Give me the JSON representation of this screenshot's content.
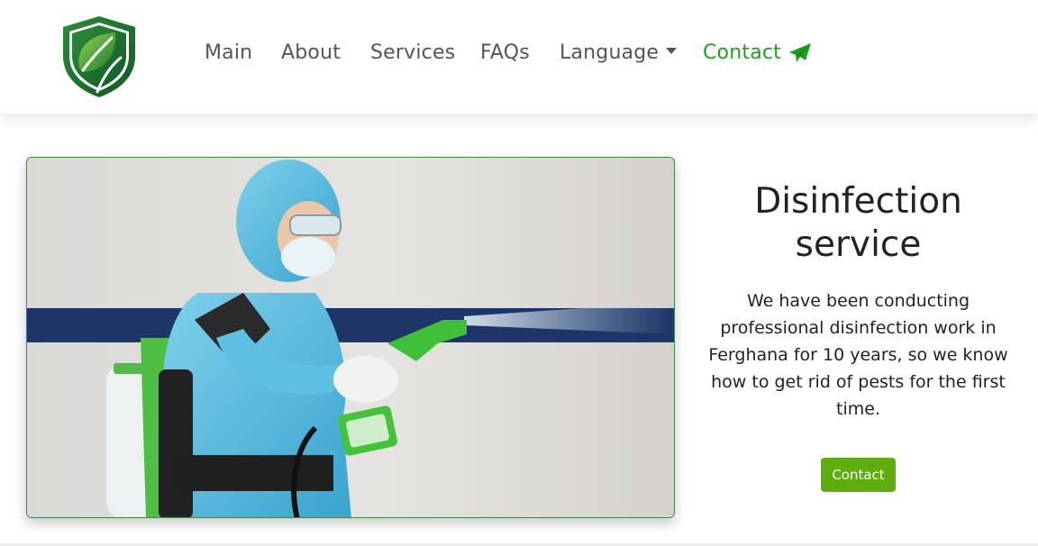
{
  "navbar": {
    "logo_icon": "shield-leaf-logo",
    "items": [
      {
        "label": "Main"
      },
      {
        "label": "About"
      },
      {
        "label": "Services"
      },
      {
        "label": "FAQs"
      },
      {
        "label": "Language"
      },
      {
        "label": "Contact"
      }
    ],
    "contact_icon": "paper-plane-icon"
  },
  "hero": {
    "title": "Disinfection service",
    "description": "We have been conducting professional disinfection work in Ferghana for 10 years, so we know how to get rid of pests for the first time.",
    "button_label": "Contact",
    "image_subject": "technician-in-protective-suit-spraying-disinfectant"
  },
  "colors": {
    "accent": "#1ba21b",
    "button": "#5fad0d",
    "text_dark": "#222222",
    "nav_text": "#555555"
  }
}
